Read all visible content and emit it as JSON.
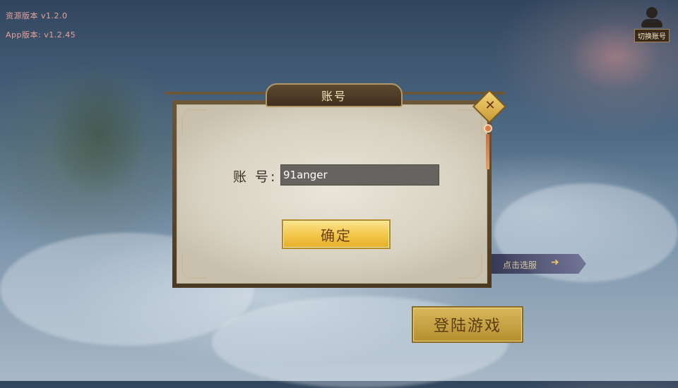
{
  "version": {
    "resource": "资源版本 v1.2.0",
    "app": "App版本: v1.2.45"
  },
  "top_right": {
    "switch_account_label": "切换账号",
    "icon": "user-icon"
  },
  "dialog": {
    "title": "账号",
    "field_label": "账 号:",
    "account_value": "91anger",
    "confirm_label": "确定",
    "close_icon": "close-icon"
  },
  "background": {
    "fold_tab_label": "点击选服",
    "fold_tab_icon": "arrow-right-icon",
    "login_button_label": "登陆游戏"
  },
  "colors": {
    "confirm_button": "#f2c649",
    "dialog_frame": "#6b5638",
    "dialog_panel": "#e9e5d9",
    "input_bg": "#676360"
  }
}
